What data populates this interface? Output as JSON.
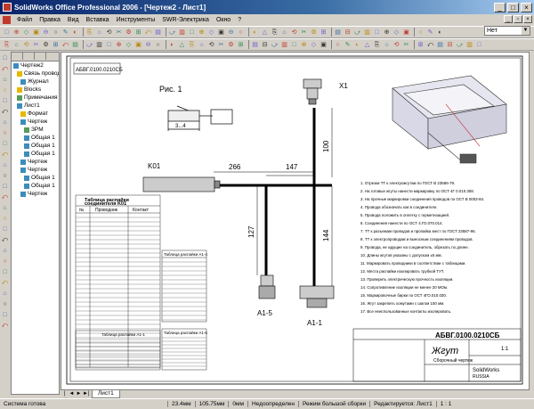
{
  "window": {
    "title": "SolidWorks Office Professional 2006 - [Чертеж2 - Лист1]"
  },
  "menu": [
    "Файл",
    "Правка",
    "Вид",
    "Вставка",
    "Инструменты",
    "SWR-Электрика",
    "Окно",
    "?"
  ],
  "layer_combo": "Нет",
  "tree": {
    "items": [
      "Чертеж2",
      "Связь проводов",
      "Журнал",
      "Blocks",
      "Примечания",
      "Лист1",
      "Формат",
      "Чертеж",
      "ЗРМ",
      "Общая 1",
      "Общая 1",
      "Общая 1",
      "Чертеж",
      "Чертеж",
      "Общая 1",
      "Общая 1",
      "Чертеж"
    ]
  },
  "sheet_tabs": [
    "Лист1"
  ],
  "status": {
    "ready": "Система готова",
    "x": "23.4мм",
    "y": "105.75мм",
    "z": "0мм",
    "constraint": "Недоопределен",
    "mode": "Режим большой сборки",
    "edit": "Редактируется: Лист1",
    "scale": "1 : 1"
  },
  "drawing": {
    "stamp_code": "АБВГ.0100.0210СБ",
    "fig_label": "Рис. 1",
    "fig_dim": "3...4",
    "connector_x1": "X1",
    "connector_k01": "K01",
    "connector_a15": "A1-5",
    "connector_a11": "A1-1",
    "dim_266": "266",
    "dim_147": "147",
    "dim_100": "100",
    "dim_144": "144",
    "dim_127": "127",
    "table_title_1": "Таблица распайки",
    "table_title_2": "соединителя K01",
    "col_no": "№",
    "col_wire": "Проводник",
    "col_contact": "Контакт",
    "small_table_a": "Таблица распайки А1-4",
    "small_table_b": "Таблица распайки А1-1",
    "small_table_c": "Таблица распайки А1-5",
    "title_block_code": "АБВГ.0100.0210СБ",
    "title_block_name": "Жгут",
    "title_block_sub": "Сборочный чертеж",
    "title_block_scale": "1:1",
    "title_block_company": "SolidWorks",
    "title_block_company2": "RUSSIA"
  },
  "notes": [
    "Отрезки ТТ к электрожгутам по ГОСТ В 23586-79.",
    "На готовые жгуты нанести маркировку по ОСТ 4Г 0.010.308.",
    "На прочные маркировки соединения проводов по ОСТ В 0003-84.",
    "Провода обозначать как в соединителе.",
    "Провода положить в оплетку с герметизацией.",
    "Соединения нанести по ОСТ 4.ГО.070.014.",
    "ТТ к разъемам проводов и пропайка мест по ГОСТ 23587-96.",
    "ТТ к электропроводам и выносным соединениям проводов.",
    "Провода, не идущие на соединитель, обрезать по длине.",
    "Длины жгутов указаны с допуском ±5 мм.",
    "Маркировать проводники в соответствии с таблицами.",
    "Места распайки изолировать трубкой ТУТ.",
    "Проверить электрическую прочность изоляции.",
    "Сопротивление изоляции не менее 20 МОм.",
    "Маркировочные бирки по ОСТ 4ГО.010.030.",
    "Жгут закрепить хомутами с шагом 150 мм.",
    "Все неиспользованные контакты изолировать."
  ]
}
